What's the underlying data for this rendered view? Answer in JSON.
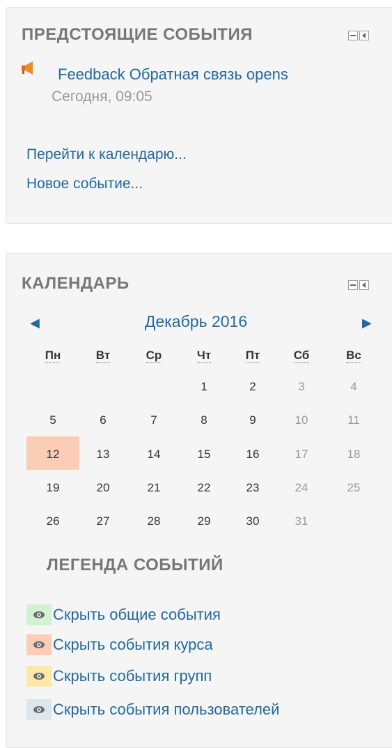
{
  "upcoming": {
    "title": "ПРЕДСТОЯЩИЕ СОБЫТИЯ",
    "event_icon": "megaphone-icon",
    "event_name": "Feedback Обратная связь opens",
    "event_time": "Сегодня, 09:05",
    "goto_calendar": "Перейти к календарю...",
    "new_event": "Новое событие..."
  },
  "calendar": {
    "title": "КАЛЕНДАРЬ",
    "prev_icon": "triangle-left-icon",
    "next_icon": "triangle-right-icon",
    "month": "Декабрь 2016",
    "weekdays": [
      "Пн",
      "Вт",
      "Ср",
      "Чт",
      "Пт",
      "Сб",
      "Вс"
    ],
    "weeks": [
      [
        "",
        "",
        "",
        "1",
        "2",
        "3",
        "4"
      ],
      [
        "5",
        "6",
        "7",
        "8",
        "9",
        "10",
        "11"
      ],
      [
        "12",
        "13",
        "14",
        "15",
        "16",
        "17",
        "18"
      ],
      [
        "19",
        "20",
        "21",
        "22",
        "23",
        "24",
        "25"
      ],
      [
        "26",
        "27",
        "28",
        "29",
        "30",
        "31",
        ""
      ]
    ],
    "today": "12",
    "today_color": "#fbcdb5"
  },
  "legend": {
    "title": "ЛЕГЕНДА СОБЫТИЙ",
    "items": [
      {
        "label": "Скрыть общие события",
        "color": "#d2f2d2"
      },
      {
        "label": "Скрыть события курса",
        "color": "#fbcdb5"
      },
      {
        "label": "Скрыть события групп",
        "color": "#fde8a7"
      },
      {
        "label": "Скрыть события пользователей",
        "color": "#dce7ec"
      }
    ]
  },
  "colors": {
    "link": "#1f6aa5",
    "muted": "#999999",
    "title": "#777777",
    "block_bg": "#f5f5f5"
  }
}
